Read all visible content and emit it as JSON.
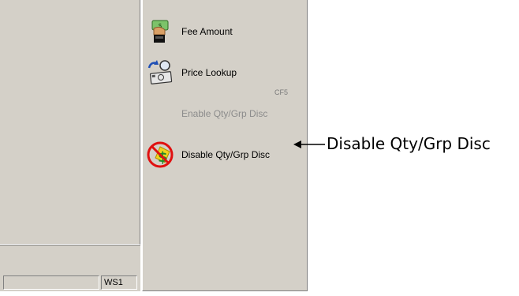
{
  "menu": {
    "items": [
      {
        "label": "Fee Amount",
        "icon": "fee-amount-icon",
        "enabled": true
      },
      {
        "label": "Price Lookup",
        "icon": "price-lookup-icon",
        "enabled": true,
        "shortcut": "CF5"
      },
      {
        "label": "Enable Qty/Grp Disc",
        "enabled": false
      },
      {
        "label": "Disable Qty/Grp Disc",
        "icon": "disable-discount-icon",
        "enabled": true
      }
    ]
  },
  "status_bar": {
    "workstation": "WS1"
  },
  "annotation": {
    "callout_text": "Disable Qty/Grp Disc"
  },
  "colors": {
    "panel_bg": "#d4d0c8",
    "disabled_text": "#8c8c8c",
    "no_symbol_red": "#e01010",
    "dollar_green": "#1f8a2a"
  }
}
